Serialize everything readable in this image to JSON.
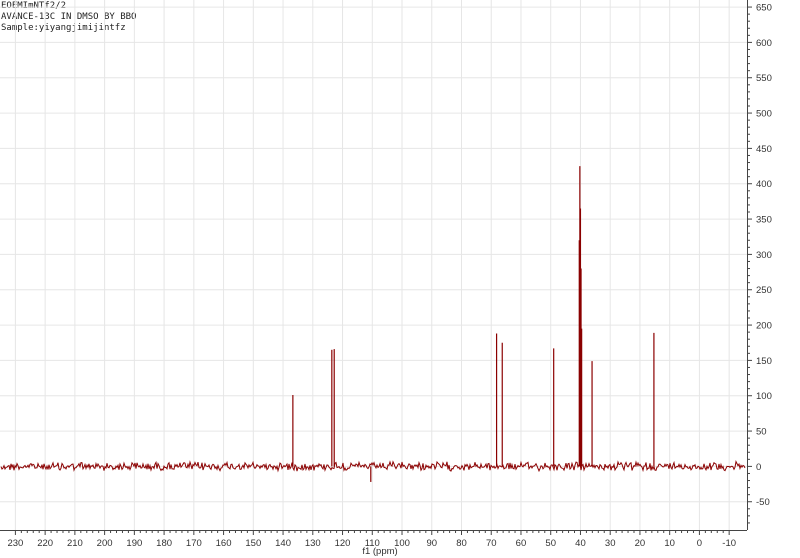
{
  "header": {
    "line1": "EOEMImNTf2/2",
    "line2": "AVANCE-13C IN DMSO BY BBO",
    "line3": "Sample:yiyangjimijintfz"
  },
  "chart_data": {
    "type": "line",
    "title": "",
    "xlabel": "f1 (ppm)",
    "ylabel": "",
    "xlim": [
      234,
      -16
    ],
    "ylim": [
      -90,
      660
    ],
    "x_reversed": true,
    "grid": true,
    "line_color": "#8b0000",
    "x_ticks": [
      230,
      220,
      210,
      200,
      190,
      180,
      170,
      160,
      150,
      140,
      130,
      120,
      110,
      100,
      90,
      80,
      70,
      60,
      50,
      40,
      30,
      20,
      10,
      0,
      -10
    ],
    "y_ticks": [
      650,
      600,
      550,
      500,
      450,
      400,
      350,
      300,
      250,
      200,
      150,
      100,
      50,
      0,
      -50
    ],
    "peaks": [
      {
        "ppm": 136.7,
        "intensity": 101
      },
      {
        "ppm": 123.6,
        "intensity": 165
      },
      {
        "ppm": 122.8,
        "intensity": 166
      },
      {
        "ppm": 110.5,
        "intensity": -22
      },
      {
        "ppm": 68.2,
        "intensity": 188
      },
      {
        "ppm": 66.3,
        "intensity": 175
      },
      {
        "ppm": 49.0,
        "intensity": 167
      },
      {
        "ppm": 40.4,
        "intensity": 320
      },
      {
        "ppm": 40.2,
        "intensity": 425
      },
      {
        "ppm": 40.0,
        "intensity": 365
      },
      {
        "ppm": 39.8,
        "intensity": 280
      },
      {
        "ppm": 39.6,
        "intensity": 195
      },
      {
        "ppm": 36.1,
        "intensity": 149
      },
      {
        "ppm": 15.3,
        "intensity": 189
      }
    ]
  }
}
